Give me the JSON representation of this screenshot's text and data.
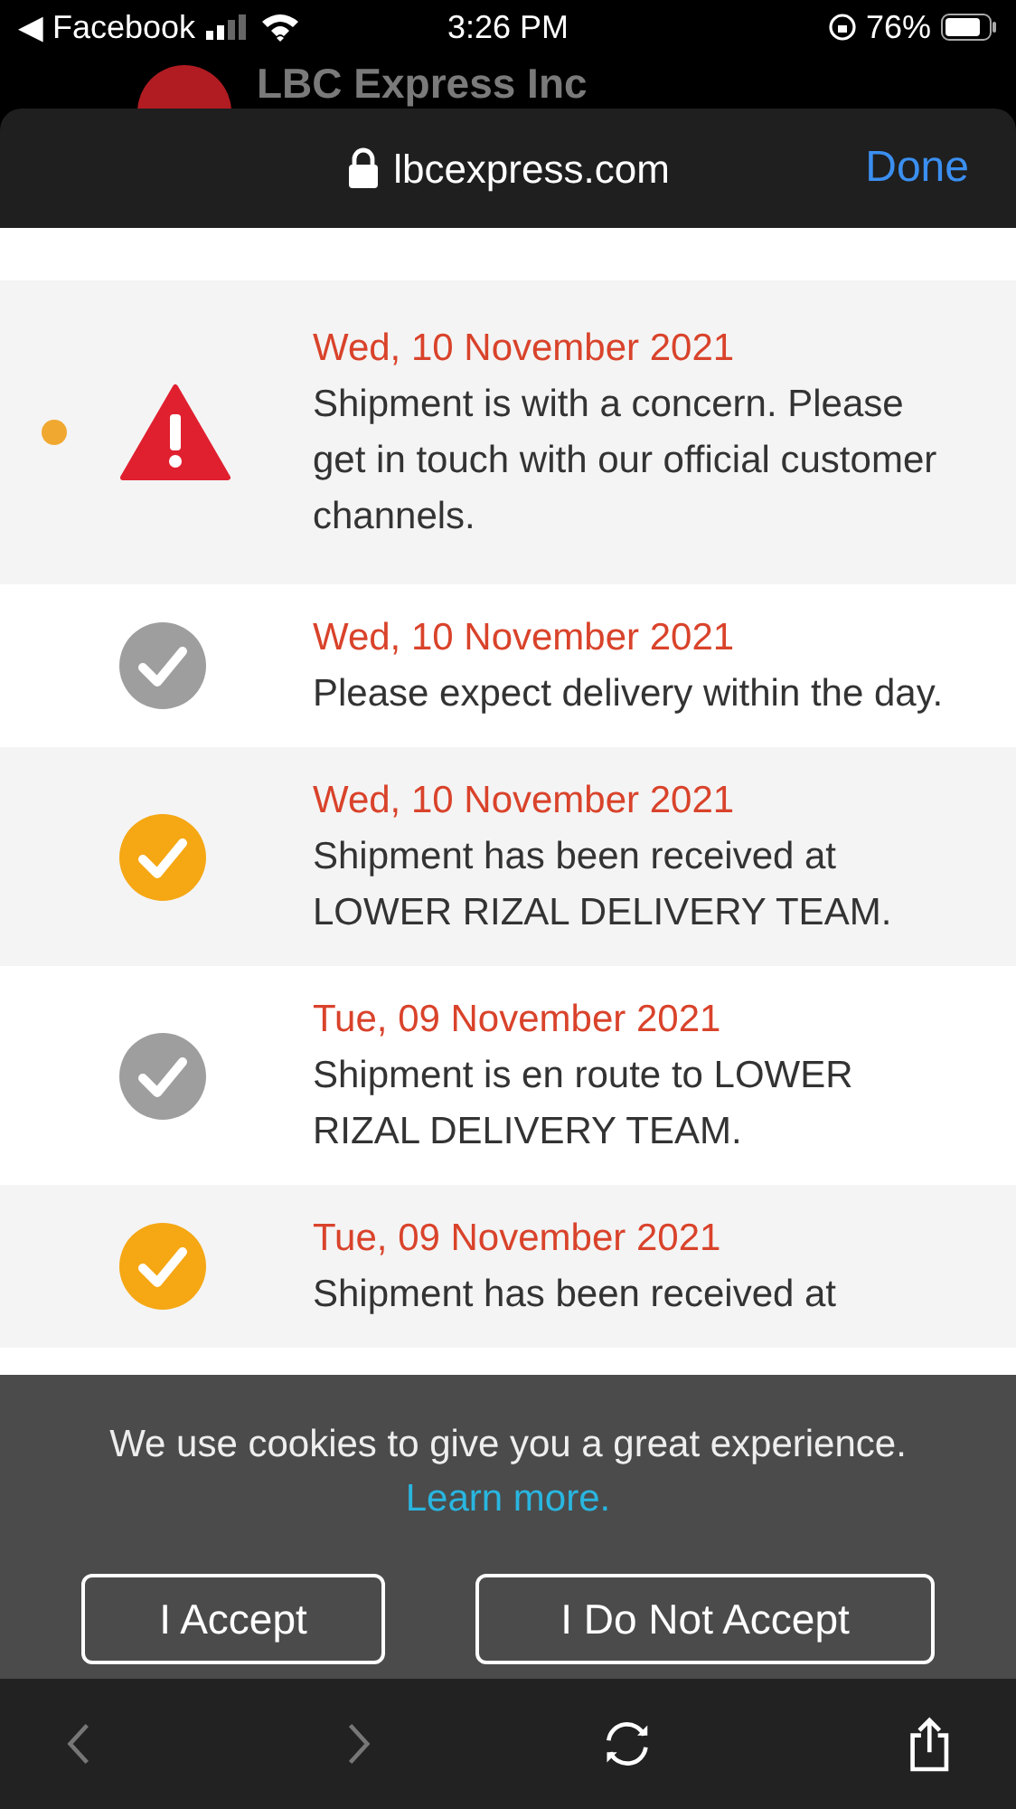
{
  "status_bar": {
    "back_app": "◀ Facebook",
    "time": "3:26 PM",
    "battery": "76%"
  },
  "app_header": {
    "title": "LBC Express Inc"
  },
  "browser": {
    "url": "lbcexpress.com",
    "done": "Done"
  },
  "events": [
    {
      "date": "Wed, 10 November 2021",
      "text": "Shipment is with a concern. Please get in touch with our official customer channels.",
      "kind": "warning",
      "dot": true,
      "color": "#e0202f"
    },
    {
      "date": "Wed, 10 November 2021",
      "text": "Please expect delivery within the day.",
      "kind": "check",
      "dot": false,
      "color": "#9e9e9e"
    },
    {
      "date": "Wed, 10 November 2021",
      "text": "Shipment has been received at LOWER RIZAL DELIVERY TEAM.",
      "kind": "check",
      "dot": false,
      "color": "#f5a714"
    },
    {
      "date": "Tue, 09 November 2021",
      "text": "Shipment is en route to LOWER RIZAL DELIVERY TEAM.",
      "kind": "check",
      "dot": false,
      "color": "#9e9e9e"
    },
    {
      "date": "Tue, 09 November 2021",
      "text": "Shipment has been received at",
      "kind": "check",
      "dot": false,
      "color": "#f5a714"
    }
  ],
  "cookie_banner": {
    "message": "We use cookies to give you a great experience.",
    "link": "Learn more.",
    "buttons": [
      "I Accept",
      "I Do Not Accept"
    ]
  }
}
